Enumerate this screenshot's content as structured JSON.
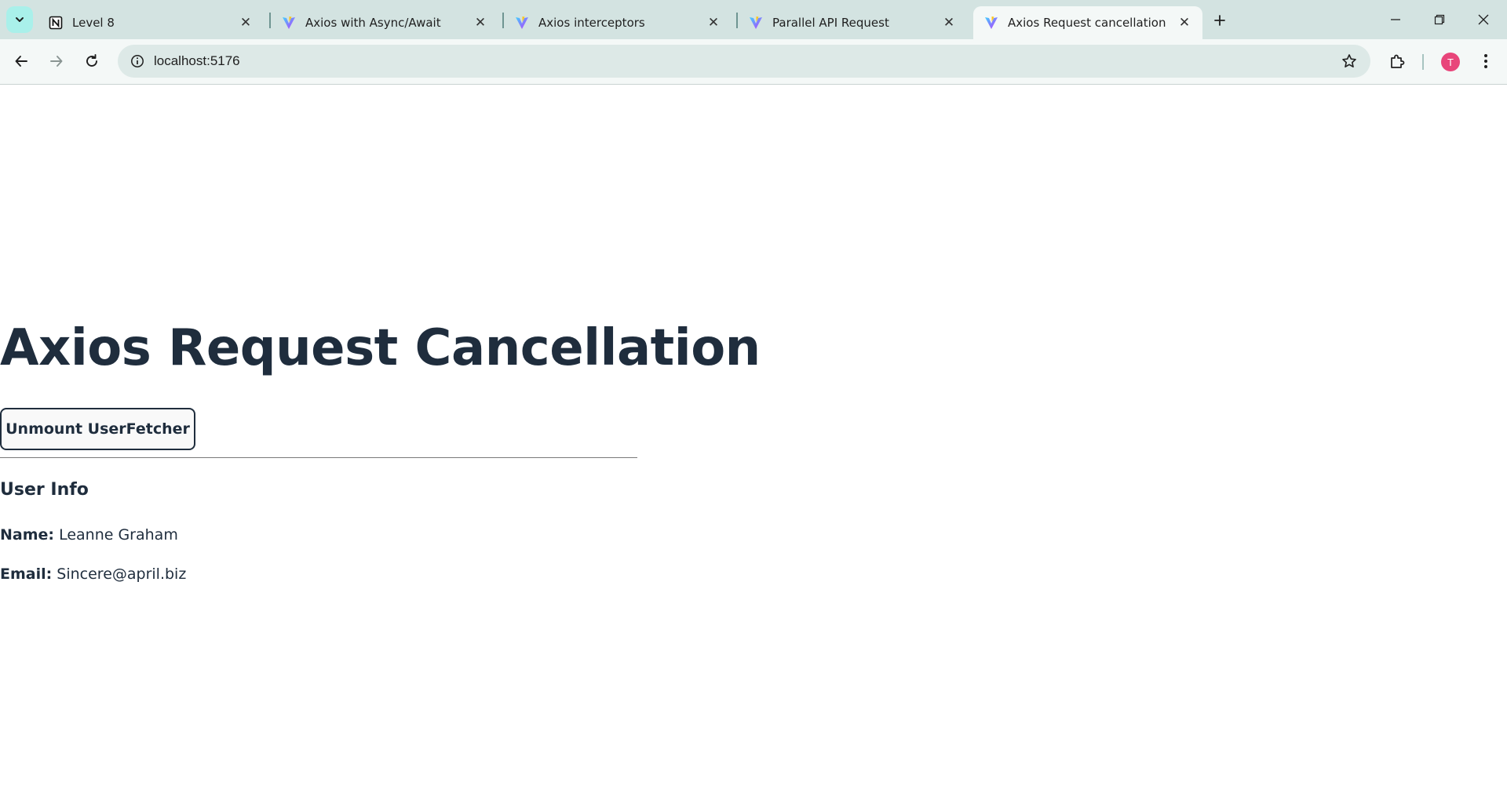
{
  "browser": {
    "tabs": [
      {
        "title": "Level 8",
        "favicon": "notion-icon",
        "active": false
      },
      {
        "title": "Axios with Async/Await",
        "favicon": "vite-icon",
        "active": false
      },
      {
        "title": "Axios interceptors",
        "favicon": "vite-icon",
        "active": false
      },
      {
        "title": "Parallel API Request",
        "favicon": "vite-icon",
        "active": false
      },
      {
        "title": "Axios Request cancellation",
        "favicon": "vite-icon",
        "active": true
      }
    ],
    "url": "localhost:5176",
    "profile_initial": "T",
    "colors": {
      "tabstrip": "#d3e3e1",
      "toolbar": "#f4f8f7",
      "avatar": "#e8457a"
    }
  },
  "page": {
    "title": "Axios Request Cancellation",
    "unmount_button": "Unmount UserFetcher",
    "user_info": {
      "heading": "User Info",
      "name_label": "Name:",
      "name_value": "Leanne Graham",
      "email_label": "Email:",
      "email_value": "Sincere@april.biz"
    },
    "colors": {
      "text": "#1f2d3d"
    }
  }
}
